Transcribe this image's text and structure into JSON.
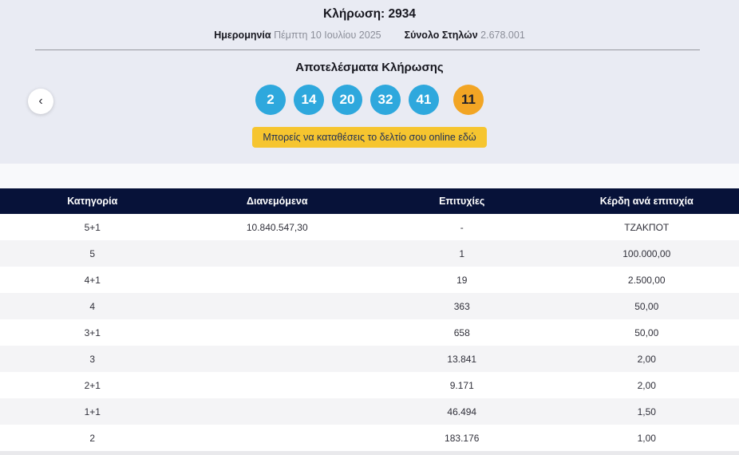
{
  "draw": {
    "title": "Κλήρωση: 2934",
    "date_label": "Ημερομηνία",
    "date_value": "Πέμπτη 10 Ιουλίου 2025",
    "columns_label": "Σύνολο Στηλών",
    "columns_value": "2.678.001"
  },
  "results": {
    "heading": "Αποτελέσματα Κλήρωσης",
    "numbers": [
      "2",
      "14",
      "20",
      "32",
      "41"
    ],
    "bonus": "11",
    "cta_label": "Μπορείς να καταθέσεις το δελτίο σου online εδώ",
    "prev_icon": "‹"
  },
  "colors": {
    "bg-top": "#e9ebf3",
    "bg-strip": "#f8f9fb",
    "navy": "#071239",
    "ball-blue": "#2ea8dd",
    "ball-orange": "#f2a524",
    "btn-yellow": "#f6c52f",
    "btn-text": "#1f2f55"
  },
  "table": {
    "headers": [
      "Κατηγορία",
      "Διανεμόμενα",
      "Επιτυχίες",
      "Κέρδη ανά επιτυχία"
    ],
    "rows": [
      [
        "5+1",
        "10.840.547,30",
        "-",
        "ΤΖΑΚΠΟΤ"
      ],
      [
        "5",
        "",
        "1",
        "100.000,00"
      ],
      [
        "4+1",
        "",
        "19",
        "2.500,00"
      ],
      [
        "4",
        "",
        "363",
        "50,00"
      ],
      [
        "3+1",
        "",
        "658",
        "50,00"
      ],
      [
        "3",
        "",
        "13.841",
        "2,00"
      ],
      [
        "2+1",
        "",
        "9.171",
        "2,00"
      ],
      [
        "1+1",
        "",
        "46.494",
        "1,50"
      ],
      [
        "2",
        "",
        "183.176",
        "1,00"
      ]
    ]
  }
}
